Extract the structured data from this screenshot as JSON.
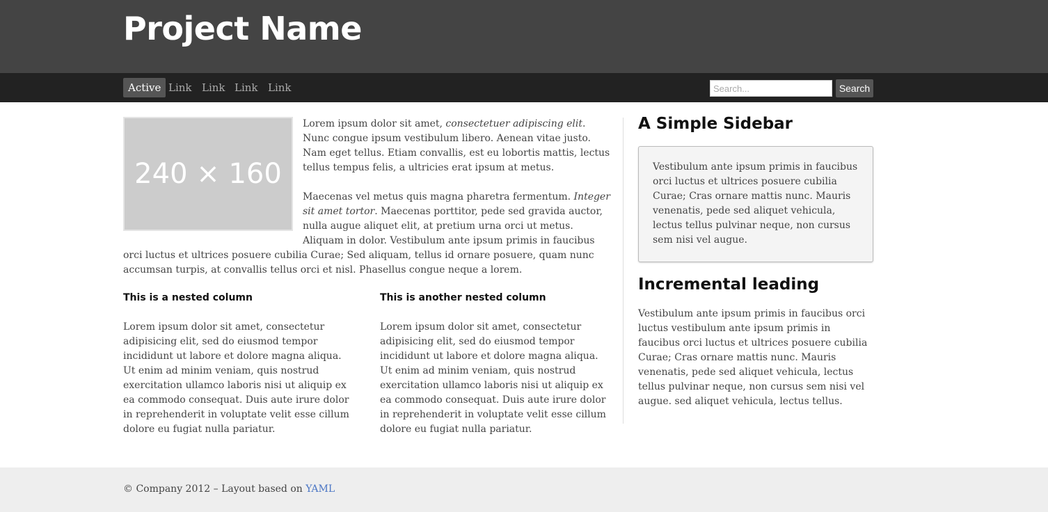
{
  "header": {
    "title": "Project Name"
  },
  "nav": {
    "items": [
      {
        "label": "Active",
        "active": true
      },
      {
        "label": "Link"
      },
      {
        "label": "Link"
      },
      {
        "label": "Link"
      },
      {
        "label": "Link"
      }
    ],
    "search_placeholder": "Search...",
    "search_button": "Search"
  },
  "main": {
    "image_label": "240 × 160",
    "para1_a": "Lorem ipsum dolor sit amet, ",
    "para1_em": "consectetuer adipiscing elit",
    "para1_b": ". Nunc congue ipsum vestibulum libero. Aenean vitae justo. Nam eget tellus. Etiam convallis, est eu lobortis mattis, lectus tellus tempus felis, a ultricies erat ipsum at metus.",
    "para2_a": "Maecenas vel metus quis magna pharetra fermentum. ",
    "para2_em": "Integer sit amet tortor",
    "para2_b": ". Maecenas porttitor, pede sed gravida auctor, nulla augue aliquet elit, at pretium urna orci ut metus. Aliquam in dolor. Vestibulum ante ipsum primis in faucibus orci luctus et ultrices posuere cubilia Curae; Sed aliquam, tellus id ornare posuere, quam nunc accumsan turpis, at convallis tellus orci et nisl. Phasellus congue neque a lorem.",
    "nested": [
      {
        "heading": "This is a nested column",
        "text": "Lorem ipsum dolor sit amet, consectetur adipisicing elit, sed do eiusmod tempor incididunt ut labore et dolore magna aliqua. Ut enim ad minim veniam, quis nostrud exercitation ullamco laboris nisi ut aliquip ex ea commodo consequat. Duis aute irure dolor in reprehenderit in voluptate velit esse cillum dolore eu fugiat nulla pariatur."
      },
      {
        "heading": "This is another nested column",
        "text": "Lorem ipsum dolor sit amet, consectetur adipisicing elit, sed do eiusmod tempor incididunt ut labore et dolore magna aliqua. Ut enim ad minim veniam, quis nostrud exercitation ullamco laboris nisi ut aliquip ex ea commodo consequat. Duis aute irure dolor in reprehenderit in voluptate velit esse cillum dolore eu fugiat nulla pariatur."
      }
    ]
  },
  "sidebar": {
    "heading1": "A Simple Sidebar",
    "box_text": "Vestibulum ante ipsum primis in faucibus orci luctus et ultrices posuere cubilia Curae; Cras ornare mattis nunc. Mauris venenatis, pede sed aliquet vehicula, lectus tellus pulvinar neque, non cursus sem nisi vel augue.",
    "heading2": "Incremental leading",
    "text2": "Vestibulum ante ipsum primis in faucibus orci luctus vestibulum ante ipsum primis in faucibus orci luctus et ultrices posuere cubilia Curae; Cras ornare mattis nunc. Mauris venenatis, pede sed aliquet vehicula, lectus tellus pulvinar neque, non cursus sem nisi vel augue. sed aliquet vehicula, lectus tellus."
  },
  "footer": {
    "text": "© Company 2012 – Layout based on ",
    "link": "YAML"
  },
  "colors": {
    "header_bg": "#444444",
    "nav_bg": "#222222",
    "active_bg": "#555555",
    "footer_bg": "#eeeeee",
    "link": "#4a75c4"
  }
}
